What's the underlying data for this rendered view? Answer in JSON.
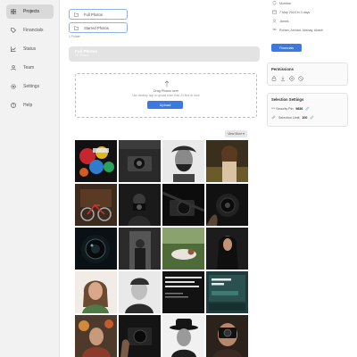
{
  "sidebar": {
    "items": [
      {
        "label": "Projects",
        "icon": "grid-icon",
        "active": true
      },
      {
        "label": "Financials",
        "icon": "tag-icon",
        "active": false
      },
      {
        "label": "Status",
        "icon": "chart-icon",
        "active": false
      },
      {
        "label": "Team",
        "icon": "team-icon",
        "active": false
      },
      {
        "label": "Settings",
        "icon": "gear-icon",
        "active": false
      },
      {
        "label": "Help",
        "icon": "help-icon",
        "active": false
      }
    ]
  },
  "folders": {
    "items": [
      {
        "label": "Full Photos",
        "icon": "folder-icon"
      },
      {
        "label": "Starred Photos",
        "icon": "folder-icon"
      }
    ],
    "count": "1 Folder"
  },
  "album": {
    "title": "Full Photos",
    "subtitle": "24 Photos"
  },
  "upload": {
    "title": "Drag Photos here",
    "subtitle": "Use desktop app to upload more than 20 files at once",
    "button": "Upload"
  },
  "view_more": "View More ▾",
  "photos": [
    {
      "name": "photo-map-art"
    },
    {
      "name": "photo-camera-bw"
    },
    {
      "name": "photo-bearded-man"
    },
    {
      "name": "photo-woman-field"
    },
    {
      "name": "photo-bicycle"
    },
    {
      "name": "photo-photographer-dark"
    },
    {
      "name": "photo-camera-lens-shadow"
    },
    {
      "name": "photo-camera-hands"
    },
    {
      "name": "photo-lens-closeup"
    },
    {
      "name": "photo-man-doorway"
    },
    {
      "name": "photo-woman-grass"
    },
    {
      "name": "photo-woman-hijab"
    },
    {
      "name": "photo-smiling-woman"
    },
    {
      "name": "photo-smiling-man"
    },
    {
      "name": "photo-screen-text"
    },
    {
      "name": "photo-screen-welcome"
    },
    {
      "name": "photo-woman-floral"
    },
    {
      "name": "photo-camera-hold"
    },
    {
      "name": "photo-man-hat"
    },
    {
      "name": "photo-man-camera-face"
    }
  ],
  "info": {
    "location": "Mumbai",
    "date": "7 May 2024 in 3 days",
    "client": "James",
    "team": "Rohan, Arshad, Akshay, Akash",
    "financials_button": "Financials"
  },
  "permissions": {
    "title": "Permissions",
    "icons": [
      "lock-icon",
      "download-icon",
      "share-icon",
      "block-icon"
    ]
  },
  "selection": {
    "title": "Selection Settings",
    "pin_label": "*** Security Pin:",
    "pin_value": "9836",
    "limit_label": "Selection Limit:",
    "limit_value": "100"
  },
  "colors": {
    "accent": "#3a7ae0",
    "sidebar_bg": "#f2f2f2",
    "active_item": "#d9d9d9"
  }
}
